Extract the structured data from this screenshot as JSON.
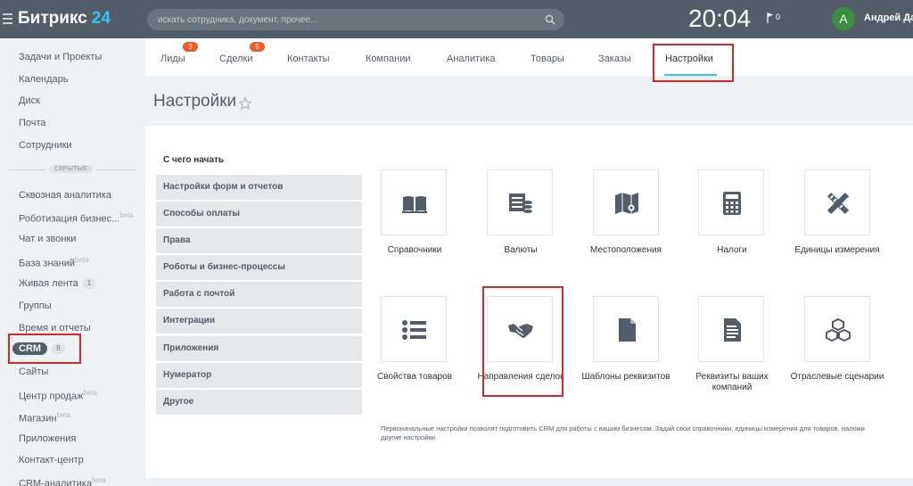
{
  "header": {
    "logo_text": "Битрикс",
    "logo_number": "24",
    "search_placeholder": "искать сотрудника, документ, прочее...",
    "clock": "20:04",
    "notifications": "0",
    "avatar_letter": "А",
    "user_name": "Андрей Дав"
  },
  "sidebar": {
    "items_top": [
      "Задачи и Проекты",
      "Календарь",
      "Диск",
      "Почта",
      "Сотрудники"
    ],
    "hidden_label": "СКРЫТЫЕ",
    "items": [
      {
        "label": "Сквозная аналитика"
      },
      {
        "label": "Роботизация бизнес...",
        "sup": "beta"
      },
      {
        "label": "Чат и звонки"
      },
      {
        "label": "База знаний",
        "sup": "beta"
      },
      {
        "label": "Живая лента",
        "badge": "1"
      },
      {
        "label": "Группы"
      },
      {
        "label": "Время и отчеты"
      },
      {
        "label": "CRM",
        "badge": "8"
      },
      {
        "label": "Сайты"
      },
      {
        "label": "Центр продаж",
        "sup": "beta"
      },
      {
        "label": "Магазин",
        "sup": "beta"
      },
      {
        "label": "Приложения"
      },
      {
        "label": "Контакт-центр"
      },
      {
        "label": "CRM-аналитика",
        "sup": "beta"
      }
    ]
  },
  "tabs": [
    {
      "label": "Лиды",
      "badge": "3"
    },
    {
      "label": "Сделки",
      "badge": "5"
    },
    {
      "label": "Контакты"
    },
    {
      "label": "Компании"
    },
    {
      "label": "Аналитика"
    },
    {
      "label": "Товары"
    },
    {
      "label": "Заказы"
    },
    {
      "label": "Настройки"
    }
  ],
  "page": {
    "title": "Настройки",
    "start_heading": "С чего начать"
  },
  "menu": [
    "Настройки форм и отчетов",
    "Способы оплаты",
    "Права",
    "Роботы и бизнес-процессы",
    "Работа с почтой",
    "Интеграции",
    "Приложения",
    "Нумератор",
    "Другое"
  ],
  "tiles": [
    {
      "label": "Справочники",
      "icon": "book-icon"
    },
    {
      "label": "Валюты",
      "icon": "currency-icon"
    },
    {
      "label": "Местоположения",
      "icon": "map-icon"
    },
    {
      "label": "Налоги",
      "icon": "calculator-icon"
    },
    {
      "label": "Единицы измерения",
      "icon": "ruler-pencil-icon"
    },
    {
      "label": "Свойства товаров",
      "icon": "list-icon"
    },
    {
      "label": "Направления сделок",
      "icon": "handshake-icon"
    },
    {
      "label": "Шаблоны реквизитов",
      "icon": "document-icon"
    },
    {
      "label": "Реквизиты ваших компаний",
      "icon": "text-document-icon"
    },
    {
      "label": "Отраслевые сценарии",
      "icon": "cubes-icon"
    }
  ],
  "footnote": "Первоначальные настройки позволят подготовить CRM для работы с вашим бизнесом. Задай свои справочники, единицы измерения для товаров, наложи",
  "footnote_line2": "другие настройки.",
  "colors": {
    "header_bg": "#535c69",
    "accent": "#2fc6f6",
    "badge": "#f15a2b",
    "highlight": "#d2282e",
    "icon": "#535c69"
  }
}
